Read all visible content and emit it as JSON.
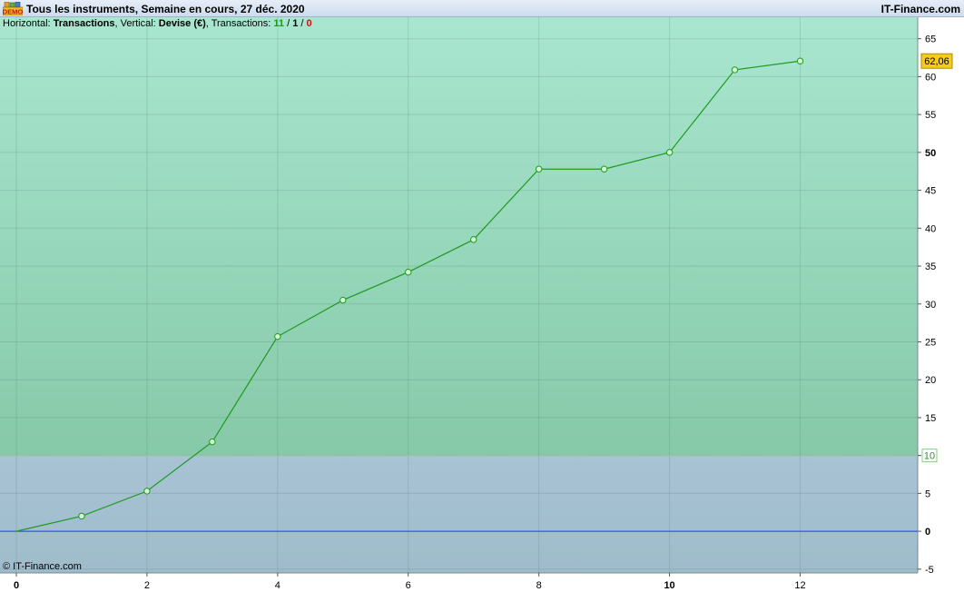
{
  "header": {
    "title": "Tous les instruments, Semaine en cours, 27 déc. 2020",
    "brand": "IT-Finance.com",
    "icon_label": "DEMO"
  },
  "info": {
    "horizontal_label": "Horizontal: ",
    "horizontal_value": "Transactions",
    "vertical_label": ", Vertical: ",
    "vertical_value": "Devise (€)",
    "transactions_label": ", Transactions: ",
    "tx_total": "11",
    "tx_sep1": " / ",
    "tx_mid": "1",
    "tx_sep2": " / ",
    "tx_zero": "0"
  },
  "footer": {
    "copyright": "© IT-Finance.com"
  },
  "colors": {
    "profit_zone_top": "#a9e6d0",
    "profit_zone_bottom": "#86c9a8",
    "loss_zone": "#a7c3d4",
    "line": "#1f9a1f",
    "zero_line": "#1a3cff",
    "last_value_badge": "#f5cc1e",
    "threshold_badge": "#7fd07f"
  },
  "chart_data": {
    "type": "line",
    "x": [
      0,
      1,
      2,
      3,
      4,
      5,
      6,
      7,
      8,
      9,
      10,
      11,
      12
    ],
    "series": [
      {
        "values": [
          0,
          2.0,
          5.3,
          11.8,
          25.7,
          30.5,
          34.2,
          38.5,
          47.8,
          47.8,
          50.0,
          60.9,
          62.06
        ]
      }
    ],
    "xlim": [
      0,
      13.8
    ],
    "ylim": [
      -5.5,
      67
    ],
    "x_ticks": [
      "0",
      "2",
      "4",
      "6",
      "8",
      "10",
      "12"
    ],
    "y_ticks": [
      "-5",
      "0",
      "5",
      "10",
      "15",
      "20",
      "25",
      "30",
      "35",
      "40",
      "45",
      "50",
      "55",
      "60",
      "65"
    ],
    "last_value_label": "62,06",
    "threshold_value": 10,
    "threshold_label": "10",
    "grid": true
  }
}
